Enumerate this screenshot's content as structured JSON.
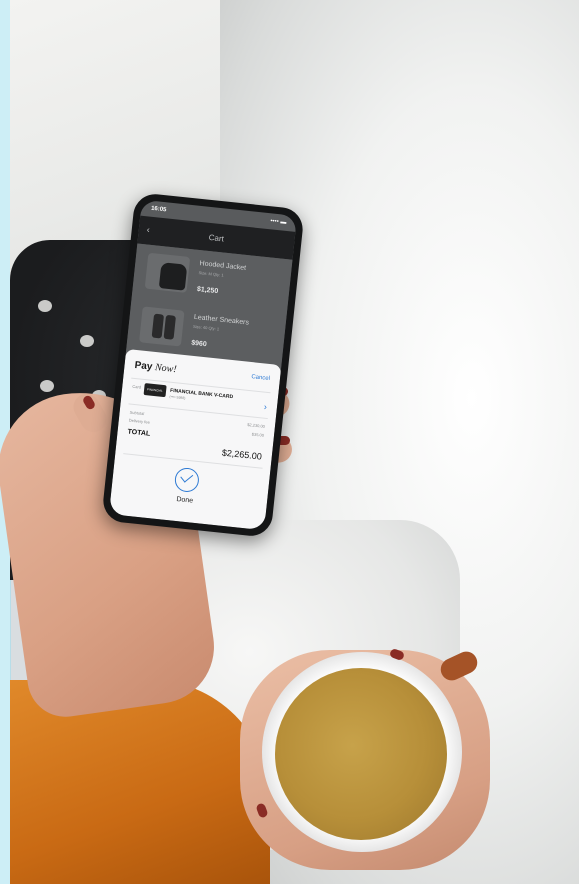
{
  "phone": {
    "status_time": "16:05",
    "status_right": "•••• ▬",
    "cart": {
      "title": "Cart",
      "items": [
        {
          "name": "Hooded Jacket",
          "meta": "Size: M      Qty: 1",
          "price": "$1,250"
        },
        {
          "name": "Leather Sneakers",
          "meta": "Size: 40      Qty: 1",
          "price": "$960"
        }
      ]
    },
    "pay_sheet": {
      "brand_bold": "Pay",
      "brand_italic": "Now!",
      "cancel": "Cancel",
      "card_label": "Card",
      "card_logo": "FINANCIAL",
      "card_name": "FINANCIAL BANK V-CARD",
      "card_number": "(•••• 5988)",
      "subtotal_label": "Subtotal",
      "subtotal_value": "$2,230.00",
      "delivery_label": "Delivery fee",
      "delivery_value": "$35.00",
      "total_label": "TOTAL",
      "total_value": "$2,265.00",
      "done": "Done"
    }
  },
  "colors": {
    "accent": "#2f7bd4",
    "sweater": "#d9791f",
    "tea": "#b78f39",
    "nail_polish": "#8a2c25"
  }
}
